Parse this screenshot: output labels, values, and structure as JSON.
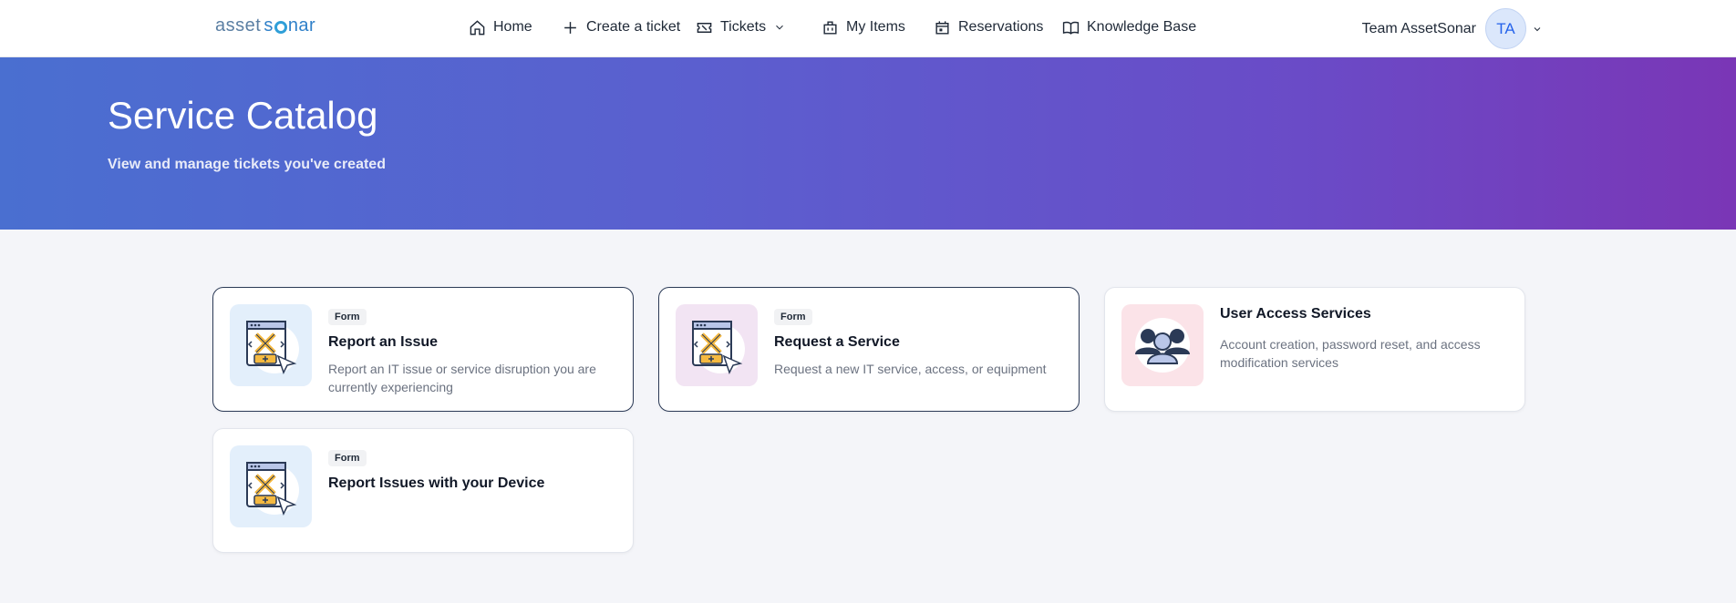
{
  "header": {
    "logo_left": "asset",
    "logo_right": "nar",
    "nav": [
      {
        "label": "Home",
        "icon": "home-icon"
      },
      {
        "label": "Create a ticket",
        "icon": "plus-icon"
      },
      {
        "label": "Tickets",
        "icon": "ticket-icon"
      },
      {
        "label": "My Items",
        "icon": "briefcase-icon"
      },
      {
        "label": "Reservations",
        "icon": "calendar-icon"
      },
      {
        "label": "Knowledge Base",
        "icon": "book-icon"
      }
    ],
    "user_name": "Team AssetSonar",
    "avatar_initials": "TA"
  },
  "hero": {
    "title": "Service Catalog",
    "subtitle": "View and manage tickets you've created"
  },
  "cards": [
    {
      "badge": "Form",
      "title": "Report an Issue",
      "description": "Report an IT issue or service disruption you are currently experiencing",
      "icon": "form-tools-icon",
      "icon_bg": "#e3effb"
    },
    {
      "badge": "Form",
      "title": "Request a Service",
      "description": "Request a new IT service, access, or equipment",
      "icon": "form-tools-icon",
      "icon_bg": "#f2e4f3"
    },
    {
      "badge": "",
      "title": "User Access Services",
      "description": "Account creation, password reset, and access modification services",
      "icon": "users-group-icon",
      "icon_bg": "#fbe3e8"
    },
    {
      "badge": "Form",
      "title": "Report Issues with your Device",
      "description": "",
      "icon": "form-tools-icon",
      "icon_bg": "#e3effb"
    }
  ],
  "colors": {
    "hero_start": "#4a6fd0",
    "hero_end": "#7a36b6",
    "active_border": "#2b3a56",
    "avatar_text": "#2563eb"
  }
}
